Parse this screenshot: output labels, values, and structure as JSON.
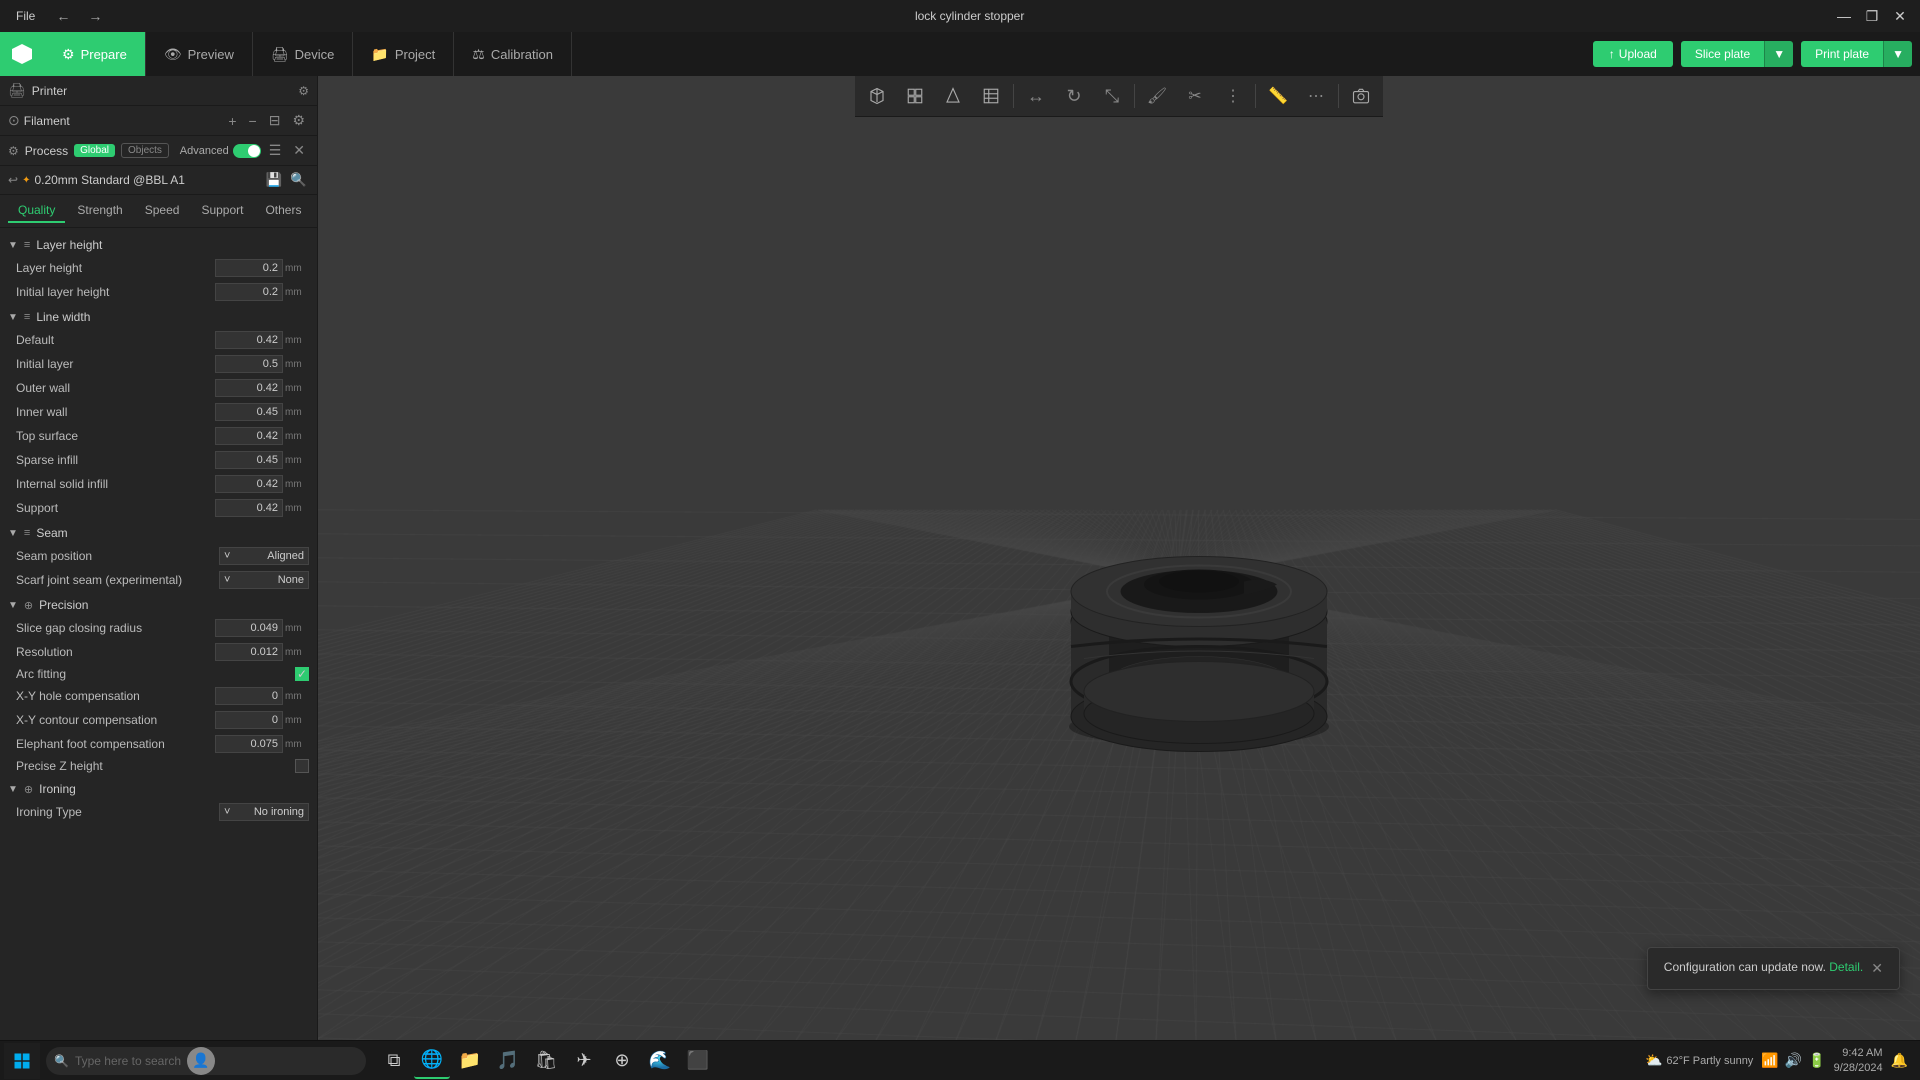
{
  "titlebar": {
    "file_menu": "File",
    "title": "lock cylinder stopper",
    "minimize": "—",
    "maximize": "❐",
    "close": "✕"
  },
  "topnav": {
    "prepare_label": "Prepare",
    "preview_label": "Preview",
    "device_label": "Device",
    "project_label": "Project",
    "calibration_label": "Calibration",
    "upload_label": "Upload",
    "slice_label": "Slice plate",
    "print_label": "Print plate"
  },
  "leftpanel": {
    "printer_label": "Printer",
    "filament_label": "Filament",
    "process_label": "Process",
    "global_label": "Global",
    "objects_label": "Objects",
    "advanced_label": "Advanced",
    "profile_name": "0.20mm Standard @BBL A1"
  },
  "quality_tabs": {
    "quality": "Quality",
    "strength": "Strength",
    "speed": "Speed",
    "support": "Support",
    "others": "Others"
  },
  "settings": {
    "layer_height_section": "Layer height",
    "layer_height_label": "Layer height",
    "layer_height_value": "0.2",
    "layer_height_unit": "mm",
    "initial_layer_height_label": "Initial layer height",
    "initial_layer_height_value": "0.2",
    "initial_layer_height_unit": "mm",
    "line_width_section": "Line width",
    "default_label": "Default",
    "default_value": "0.42",
    "default_unit": "mm",
    "initial_layer_label": "Initial layer",
    "initial_layer_value": "0.5",
    "initial_layer_unit": "mm",
    "outer_wall_label": "Outer wall",
    "outer_wall_value": "0.42",
    "outer_wall_unit": "mm",
    "inner_wall_label": "Inner wall",
    "inner_wall_value": "0.45",
    "inner_wall_unit": "mm",
    "top_surface_label": "Top surface",
    "top_surface_value": "0.42",
    "top_surface_unit": "mm",
    "sparse_infill_label": "Sparse infill",
    "sparse_infill_value": "0.45",
    "sparse_infill_unit": "mm",
    "internal_solid_infill_label": "Internal solid infill",
    "internal_solid_infill_value": "0.42",
    "internal_solid_infill_unit": "mm",
    "support_label": "Support",
    "support_value": "0.42",
    "support_unit": "mm",
    "seam_section": "Seam",
    "seam_position_label": "Seam position",
    "seam_position_value": "Aligned",
    "scarf_joint_label": "Scarf joint seam (experimental)",
    "scarf_joint_value": "None",
    "precision_section": "Precision",
    "slice_gap_label": "Slice gap closing radius",
    "slice_gap_value": "0.049",
    "slice_gap_unit": "mm",
    "resolution_label": "Resolution",
    "resolution_value": "0.012",
    "resolution_unit": "mm",
    "arc_fitting_label": "Arc fitting",
    "xy_hole_label": "X-Y hole compensation",
    "xy_hole_value": "0",
    "xy_hole_unit": "mm",
    "xy_contour_label": "X-Y contour compensation",
    "xy_contour_value": "0",
    "xy_contour_unit": "mm",
    "elephant_foot_label": "Elephant foot compensation",
    "elephant_foot_value": "0.075",
    "elephant_foot_unit": "mm",
    "precise_z_label": "Precise Z height",
    "ironing_section": "Ironing",
    "ironing_type_label": "Ironing Type",
    "ironing_type_value": "No ironing"
  },
  "viewport": {
    "toolbar_icons": [
      "⬡",
      "⊞",
      "⬟",
      "▦",
      "◉",
      "⊕",
      "⟳",
      "⊘",
      "⬛",
      "⬜",
      "◎",
      "⊡"
    ]
  },
  "notification": {
    "text": "Configuration can update now.",
    "link_text": "Detail.",
    "close": "✕"
  },
  "taskbar": {
    "search_placeholder": "Type here to search",
    "weather": "62°F Partly sunny",
    "time": "9:42 AM",
    "date": "9/28/2024"
  }
}
